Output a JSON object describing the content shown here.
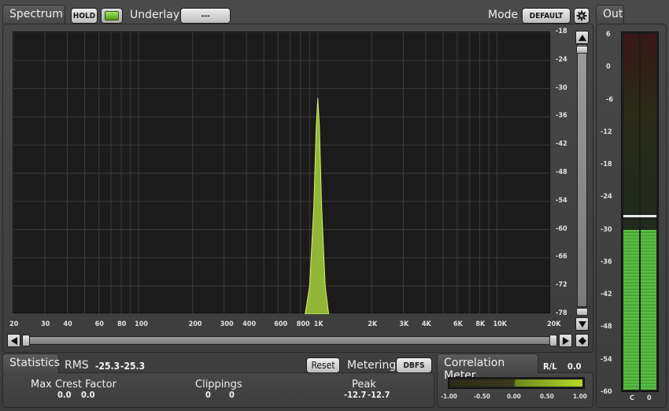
{
  "spectrum": {
    "tab_label": "Spectrum",
    "hold_label": "HOLD",
    "underlay_label": "Underlay",
    "underlay_value": "---",
    "mode_label": "Mode",
    "mode_value": "DEFAULT",
    "x_ticks": [
      "20",
      "30",
      "40",
      "60",
      "80",
      "100",
      "200",
      "300",
      "400",
      "600",
      "800",
      "1K",
      "2K",
      "3K",
      "4K",
      "6K",
      "8K",
      "10K",
      "20K"
    ],
    "y_ticks": [
      "-18",
      "-24",
      "-30",
      "-36",
      "-42",
      "-48",
      "-54",
      "-60",
      "-66",
      "-72",
      "-78"
    ]
  },
  "chart_data": {
    "type": "area",
    "x_scale": "log",
    "xlim": [
      20,
      20000
    ],
    "ylim": [
      -78,
      -18
    ],
    "ylabel": "",
    "xlabel": "",
    "title": "",
    "grid": true,
    "series": [
      {
        "x": [
          850,
          900,
          950,
          980,
          1000,
          1020,
          1050,
          1100,
          1150
        ],
        "y": [
          -78,
          -72,
          -55,
          -38,
          -32,
          -38,
          -55,
          -72,
          -78
        ]
      }
    ],
    "color": "#a6d13a"
  },
  "out": {
    "tab_label": "Out",
    "scale": [
      "6",
      "0",
      "-6",
      "-12",
      "-18",
      "-24",
      "-30",
      "-36",
      "-42",
      "-48",
      "-54",
      "-60"
    ],
    "channel_labels": [
      "C",
      "0"
    ],
    "level_db": -30.5,
    "peak_hold_db": -27.5
  },
  "statistics": {
    "tab_label": "Statistics",
    "rms_label": "RMS",
    "rms_values": [
      "-25.3",
      "-25.3"
    ],
    "reset_label": "Reset",
    "metering_label": "Metering",
    "metering_value": "DBFS",
    "max_crest_label": "Max Crest Factor",
    "max_crest_values": [
      "0.0",
      "0.0"
    ],
    "clippings_label": "Clippings",
    "clippings_values": [
      "0",
      "0"
    ],
    "peak_label": "Peak",
    "peak_values": [
      "-12.7",
      "-12.7"
    ]
  },
  "correlation": {
    "tab_label": "Correlation Meter",
    "rl_label": "R/L",
    "rl_value": "0.0",
    "scale": [
      "-1.00",
      "-0.50",
      "0.00",
      "0.50",
      "1.00"
    ]
  }
}
